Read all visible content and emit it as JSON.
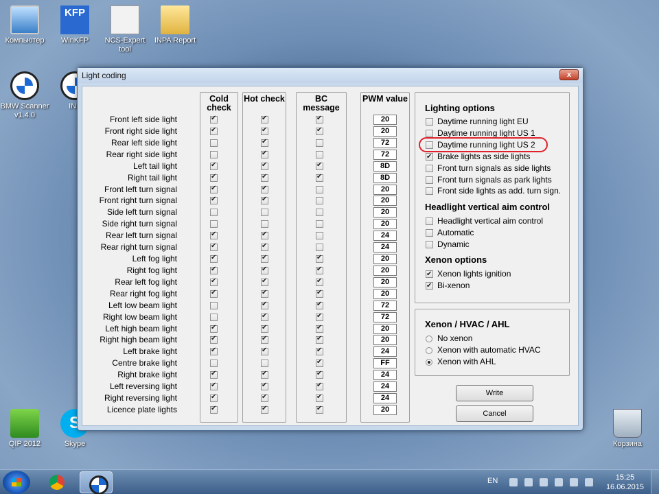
{
  "desktop": {
    "icons_top": [
      {
        "label": "Компьютер",
        "name": "computer"
      },
      {
        "label": "WinKFP",
        "name": "winkfp",
        "glyph": "KFP"
      },
      {
        "label": "NCS-Expert tool",
        "name": "ncs-expert"
      },
      {
        "label": "INPA Report",
        "name": "inpa-report"
      }
    ],
    "icons_left": [
      {
        "label": "BMW Scanner v1.4.0",
        "name": "bmw-scanner"
      },
      {
        "label": "INF",
        "name": "inpa"
      }
    ],
    "icons_bottom": [
      {
        "label": "QIP 2012",
        "name": "qip"
      },
      {
        "label": "Skype",
        "name": "skype",
        "glyph": "S"
      },
      {
        "label": "Корзина",
        "name": "recycle-bin"
      }
    ]
  },
  "window": {
    "title": "Light coding",
    "close_glyph": "x",
    "columns": {
      "cold": "Cold check",
      "hot": "Hot check",
      "bc": "BC message",
      "pwm": "PWM value"
    },
    "rows": [
      {
        "label": "Front left side light",
        "cold": true,
        "hot": true,
        "bc": true,
        "pwm": "20"
      },
      {
        "label": "Front right side light",
        "cold": true,
        "hot": true,
        "bc": true,
        "pwm": "20"
      },
      {
        "label": "Rear left side light",
        "cold": false,
        "hot": true,
        "bc": false,
        "pwm": "72"
      },
      {
        "label": "Rear right side light",
        "cold": false,
        "hot": true,
        "bc": false,
        "pwm": "72"
      },
      {
        "label": "Left tail light",
        "cold": true,
        "hot": true,
        "bc": true,
        "pwm": "8D"
      },
      {
        "label": "Right tail light",
        "cold": true,
        "hot": true,
        "bc": true,
        "pwm": "8D"
      },
      {
        "label": "Front left turn signal",
        "cold": true,
        "hot": true,
        "bc": false,
        "pwm": "20"
      },
      {
        "label": "Front right turn signal",
        "cold": true,
        "hot": true,
        "bc": false,
        "pwm": "20"
      },
      {
        "label": "Side left turn signal",
        "cold": false,
        "hot": false,
        "bc": false,
        "pwm": "20"
      },
      {
        "label": "Side right turn signal",
        "cold": false,
        "hot": false,
        "bc": false,
        "pwm": "20"
      },
      {
        "label": "Rear left turn signal",
        "cold": true,
        "hot": true,
        "bc": false,
        "pwm": "24"
      },
      {
        "label": "Rear right turn signal",
        "cold": true,
        "hot": true,
        "bc": false,
        "pwm": "24"
      },
      {
        "label": "Left fog light",
        "cold": true,
        "hot": true,
        "bc": true,
        "pwm": "20"
      },
      {
        "label": "Right fog light",
        "cold": true,
        "hot": true,
        "bc": true,
        "pwm": "20"
      },
      {
        "label": "Rear left fog light",
        "cold": true,
        "hot": true,
        "bc": true,
        "pwm": "20"
      },
      {
        "label": "Rear right fog light",
        "cold": true,
        "hot": true,
        "bc": true,
        "pwm": "20"
      },
      {
        "label": "Left low beam light",
        "cold": false,
        "hot": true,
        "bc": true,
        "pwm": "72"
      },
      {
        "label": "Right low beam light",
        "cold": false,
        "hot": true,
        "bc": true,
        "pwm": "72"
      },
      {
        "label": "Left high beam light",
        "cold": true,
        "hot": true,
        "bc": true,
        "pwm": "20"
      },
      {
        "label": "Right high beam light",
        "cold": true,
        "hot": true,
        "bc": true,
        "pwm": "20"
      },
      {
        "label": "Left brake light",
        "cold": true,
        "hot": true,
        "bc": true,
        "pwm": "24"
      },
      {
        "label": "Centre brake light",
        "cold": false,
        "hot": false,
        "bc": true,
        "pwm": "FF"
      },
      {
        "label": "Right brake light",
        "cold": true,
        "hot": true,
        "bc": true,
        "pwm": "24"
      },
      {
        "label": "Left reversing light",
        "cold": true,
        "hot": true,
        "bc": true,
        "pwm": "24"
      },
      {
        "label": "Right reversing light",
        "cold": true,
        "hot": true,
        "bc": true,
        "pwm": "24"
      },
      {
        "label": "Licence plate lights",
        "cold": true,
        "hot": true,
        "bc": true,
        "pwm": "20"
      }
    ],
    "lighting_options": {
      "title": "Lighting options",
      "items": [
        {
          "label": "Daytime running light EU",
          "checked": false
        },
        {
          "label": "Daytime running light US 1",
          "checked": false
        },
        {
          "label": "Daytime running light US 2",
          "checked": false
        },
        {
          "label": "Brake lights as side lights",
          "checked": true
        },
        {
          "label": "Front turn signals as side lights",
          "checked": false
        },
        {
          "label": "Front turn signals as park lights",
          "checked": false
        },
        {
          "label": "Front side lights as add. turn sign.",
          "checked": false
        }
      ]
    },
    "headlight_aim": {
      "title": "Headlight vertical aim control",
      "items": [
        {
          "label": "Headlight vertical aim control",
          "checked": false
        },
        {
          "label": "Automatic",
          "checked": false
        },
        {
          "label": "Dynamic",
          "checked": false
        }
      ]
    },
    "xenon_options": {
      "title": "Xenon options",
      "items": [
        {
          "label": "Xenon lights ignition",
          "checked": true
        },
        {
          "label": "Bi-xenon",
          "checked": true
        }
      ]
    },
    "xenon_hvac": {
      "title": "Xenon / HVAC / AHL",
      "items": [
        {
          "label": "No xenon",
          "selected": false
        },
        {
          "label": "Xenon with automatic HVAC",
          "selected": false
        },
        {
          "label": "Xenon with AHL",
          "selected": true
        }
      ]
    },
    "buttons": {
      "write": "Write",
      "cancel": "Cancel"
    },
    "highlight_color": "#e0202a"
  },
  "taskbar": {
    "language": "EN",
    "time": "15:25",
    "date": "16.06.2015"
  }
}
